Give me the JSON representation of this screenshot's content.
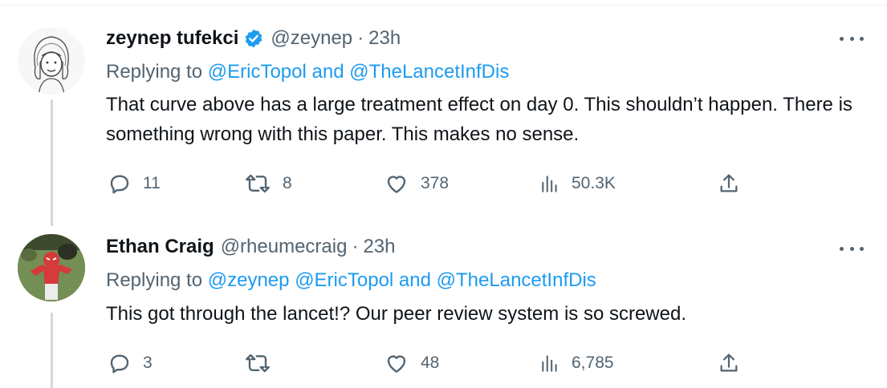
{
  "colors": {
    "link": "#1d9bf0",
    "secondary": "#536471",
    "primary": "#0f1419",
    "thread_line": "#cfd9de"
  },
  "tweets": [
    {
      "display_name": "zeynep tufekci",
      "verified": true,
      "handle": "@zeynep",
      "separator": "·",
      "time": "23h",
      "replying_prefix": "Replying to",
      "replying_to": [
        {
          "text": "@EricTopol",
          "type": "link"
        },
        {
          "text": " and ",
          "type": "plain"
        },
        {
          "text": "@TheLancetInfDis",
          "type": "link"
        }
      ],
      "text": "That curve above has a large treatment effect on day 0. This shouldn’t happen. There is something wrong with this paper. This makes no sense.",
      "stats": {
        "replies": "11",
        "retweets": "8",
        "likes": "378",
        "views": "50.3K"
      },
      "icons": [
        "reply-icon",
        "retweet-icon",
        "like-icon",
        "views-icon",
        "share-icon",
        "more-icon"
      ]
    },
    {
      "display_name": "Ethan Craig",
      "verified": false,
      "handle": "@rheumecraig",
      "separator": "·",
      "time": "23h",
      "replying_prefix": "Replying to",
      "replying_to": [
        {
          "text": "@zeynep",
          "type": "link"
        },
        {
          "text": " ",
          "type": "plain"
        },
        {
          "text": "@EricTopol",
          "type": "link"
        },
        {
          "text": " and ",
          "type": "plain"
        },
        {
          "text": "@TheLancetInfDis",
          "type": "link"
        }
      ],
      "text": "This got through the lancet!? Our peer review system is so screwed.",
      "stats": {
        "replies": "3",
        "retweets": "",
        "likes": "48",
        "views": "6,785"
      },
      "icons": [
        "reply-icon",
        "retweet-icon",
        "like-icon",
        "views-icon",
        "share-icon",
        "more-icon"
      ]
    }
  ]
}
